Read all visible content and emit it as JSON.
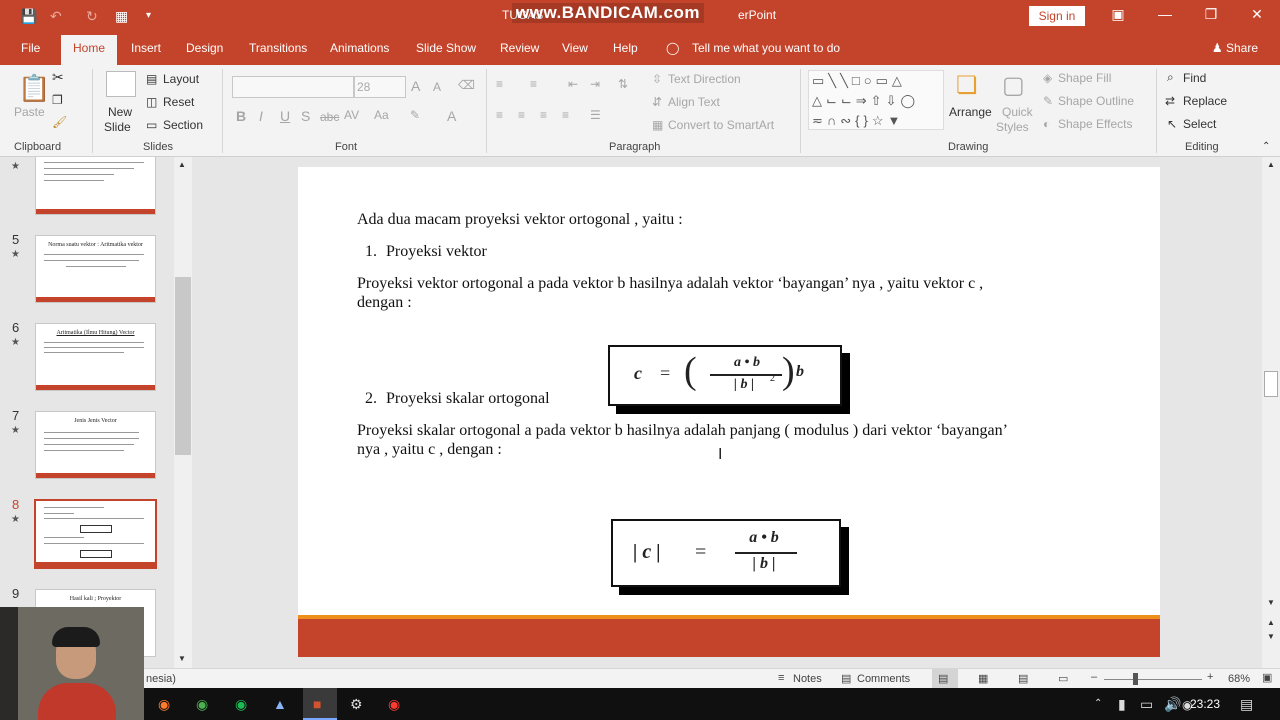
{
  "window": {
    "title": "TUGAS",
    "title_suffix": "erPoint",
    "watermark": "www.BANDICAM.com",
    "sign_in": "Sign in"
  },
  "tabs": [
    "File",
    "Home",
    "Insert",
    "Design",
    "Transitions",
    "Animations",
    "Slide Show",
    "Review",
    "View",
    "Help"
  ],
  "tell_me": "Tell me what you want to do",
  "share": "Share",
  "ribbon": {
    "clipboard": {
      "label": "Clipboard",
      "paste": "Paste"
    },
    "slides": {
      "label": "Slides",
      "new_slide": "New",
      "new_slide2": "Slide",
      "layout": "Layout",
      "reset": "Reset",
      "section": "Section"
    },
    "font": {
      "label": "Font",
      "size": "28"
    },
    "paragraph": {
      "label": "Paragraph",
      "text_direction": "Text Direction",
      "align_text": "Align Text",
      "convert": "Convert to SmartArt"
    },
    "drawing": {
      "label": "Drawing",
      "arrange": "Arrange",
      "quick_styles": "Quick",
      "quick_styles2": "Styles",
      "shape_fill": "Shape Fill",
      "shape_outline": "Shape Outline",
      "shape_effects": "Shape Effects"
    },
    "editing": {
      "label": "Editing",
      "find": "Find",
      "replace": "Replace",
      "select": "Select"
    }
  },
  "thumbnails": [
    {
      "num": "5",
      "title": "Norma suatu vektor : Aritmatika vektor"
    },
    {
      "num": "6",
      "title": "Aritmatika (Ilmu Hitung) Vector"
    },
    {
      "num": "7",
      "title": "Jenis Jenis Vector"
    },
    {
      "num": "8",
      "title": ""
    },
    {
      "num": "9",
      "title": "Hasil kali ; Proyektor"
    }
  ],
  "slide": {
    "line1": "Ada dua macam proyeksi vektor ortogonal , yaitu :",
    "item1_num": "1.",
    "item1": "Proyeksi vektor",
    "para1a": "Proyeksi vektor ortogonal a pada vektor b hasilnya adalah vektor ‘bayangan’ nya , yaitu vektor c ,",
    "para1b": "dengan :",
    "item2_num": "2.",
    "item2": "Proyeksi skalar ortogonal",
    "para2a": "Proyeksi skalar ortogonal a pada vektor b hasilnya adalah panjang ( modulus ) dari vektor ‘bayangan’",
    "para2b": "nya , yaitu c , dengan :",
    "formula1": {
      "lhs": "c",
      "eq": "=",
      "num": "a • b",
      "den": "| b |",
      "exp": "2",
      "rhs": "b"
    },
    "formula2": {
      "lhs": "| c |",
      "eq": "=",
      "num": "a • b",
      "den": "| b |"
    }
  },
  "status": {
    "language": "nesia)",
    "notes": "Notes",
    "comments": "Comments",
    "zoom": "68%"
  },
  "taskbar": {
    "time": "23:23"
  }
}
